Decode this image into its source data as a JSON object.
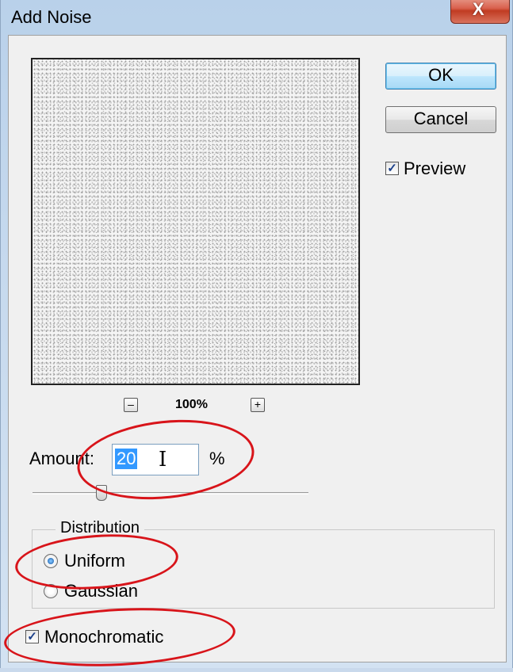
{
  "window": {
    "title": "Add Noise",
    "close_glyph": "X"
  },
  "buttons": {
    "ok": "OK",
    "cancel": "Cancel"
  },
  "preview_checkbox": {
    "label": "Preview",
    "checked": true
  },
  "zoom": {
    "minus": "–",
    "plus": "+",
    "level": "100%"
  },
  "amount": {
    "label": "Amount:",
    "value": "20",
    "unit": "%",
    "slider_value": 20
  },
  "distribution": {
    "legend": "Distribution",
    "options": [
      {
        "label": "Uniform",
        "selected": true
      },
      {
        "label": "Gaussian",
        "selected": false
      }
    ]
  },
  "monochromatic": {
    "label": "Monochromatic",
    "checked": true
  },
  "colors": {
    "annotation": "#d8141a",
    "selection": "#3399ff",
    "ok_border": "#3c7fb1"
  }
}
